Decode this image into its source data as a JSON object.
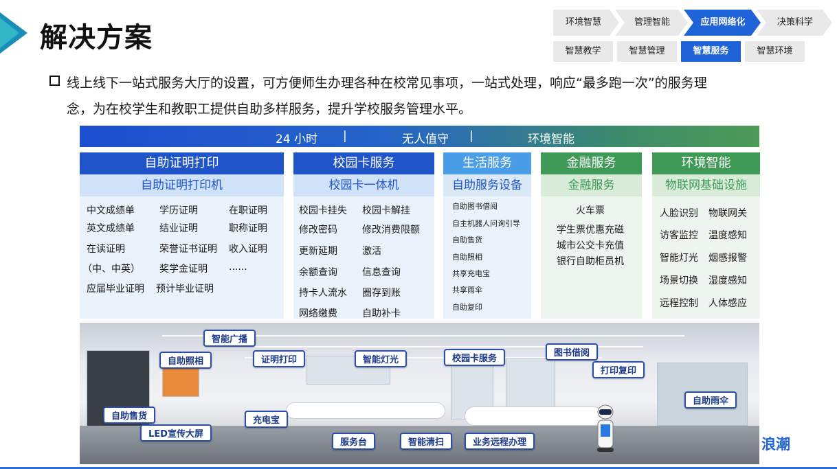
{
  "title": "解决方案",
  "nav": {
    "top": [
      {
        "label": "环境智慧化",
        "active": false
      },
      {
        "label": "管理智能化",
        "active": false
      },
      {
        "label": "应用网络化",
        "active": true
      },
      {
        "label": "决策科学化",
        "active": false
      }
    ],
    "sub": [
      {
        "label": "智慧教学",
        "active": false
      },
      {
        "label": "智慧管理",
        "active": false
      },
      {
        "label": "智慧服务",
        "active": true
      },
      {
        "label": "智慧环境",
        "active": false
      }
    ]
  },
  "paragraph": {
    "line1": "线上线下一站式服务大厅的设置，可方便师生办理各种在校常见事项，一站式处理，响应“最多跑一次”的服务理",
    "line2": "念，为在校学生和教职工提供自助多样服务，提升学校服务管理水平。"
  },
  "banner": {
    "items": [
      "24 小时",
      "|",
      "无人值守",
      "|",
      "环境智能"
    ]
  },
  "columns": {
    "print": {
      "title": "自助证明打印",
      "subtitle": "自助证明打印机",
      "items": [
        "中文成绩单",
        "学历证明",
        "在职证明",
        "英文成绩单",
        "结业证明",
        "职称证明",
        "在读证明",
        "荣誉证书证明",
        "收入证明",
        "（中、中英）",
        "奖学金证明",
        "......",
        "应届毕业证明",
        "预计毕业证明"
      ]
    },
    "card": {
      "title": "校园卡服务",
      "subtitle": "校园卡一体机",
      "items": [
        "校园卡挂失",
        "校园卡解挂",
        "修改密码",
        "修改消费限额",
        "更新延期",
        "激活",
        "余额查询",
        "信息查询",
        "持卡人流水",
        "圈存到账",
        "网络缴费",
        "自助补卡"
      ]
    },
    "life": {
      "title": "生活服务",
      "subtitle": "自助服务设备",
      "items": [
        "自助图书借阅",
        "自主机器人问询引导",
        "自助售货",
        "自助照相",
        "共享充电宝",
        "共享雨伞",
        "自助复印"
      ]
    },
    "finance": {
      "title": "金融服务",
      "subtitle": "金融服务",
      "items": [
        "火车票",
        "学生票优惠充磁",
        "城市公交卡充值",
        "银行自助柜员机"
      ]
    },
    "env": {
      "title": "环境智能",
      "subtitle": "物联网基础设施",
      "items": [
        "人脸识别",
        "物联网关",
        "访客监控",
        "温度感知",
        "智能灯光",
        "烟感报警",
        "场景切换",
        "湿度感知",
        "远程控制",
        "人体感应"
      ]
    }
  },
  "photo_labels": [
    "智能广播",
    "自助照相",
    "证明打印",
    "智能灯光",
    "校园卡服务",
    "图书借阅",
    "打印复印",
    "自助售货",
    "LED宣传大屏",
    "充电宝",
    "服务台",
    "智能清扫",
    "业务远程办理",
    "自助雨伞"
  ],
  "brand": "浪潮",
  "colors": {
    "accent_blue": "#1e63d8",
    "print_head": "#1f55c9",
    "card_head": "#1f55c9",
    "life_head": "#4a9ee8",
    "finance_head": "#3f9a57",
    "env_head": "#3f9a57"
  }
}
